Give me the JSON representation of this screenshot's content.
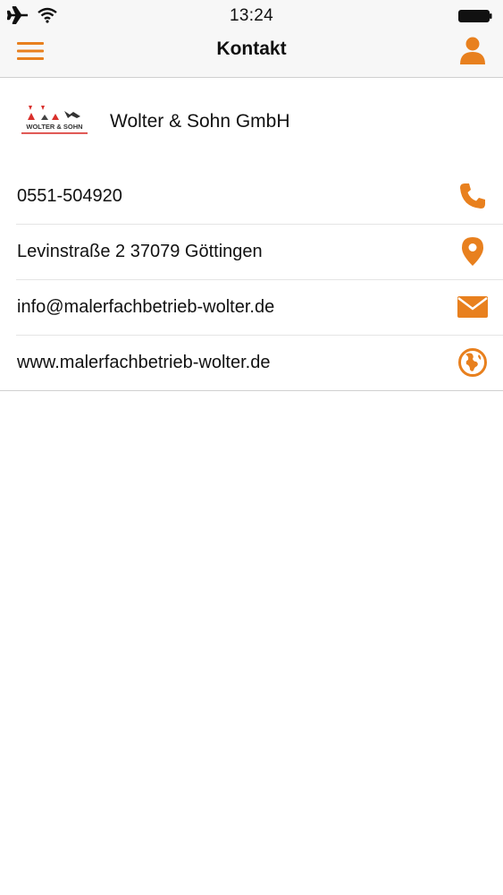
{
  "status_bar": {
    "time": "13:24"
  },
  "nav": {
    "title": "Kontakt"
  },
  "company": {
    "name": "Wolter & Sohn GmbH",
    "logo_text": "WOLTER & SOHN"
  },
  "contacts": [
    {
      "label": "0551-504920",
      "icon": "phone-icon"
    },
    {
      "label": "Levinstraße 2 37079 Göttingen",
      "icon": "location-pin-icon"
    },
    {
      "label": "info@malerfachbetrieb-wolter.de",
      "icon": "mail-icon"
    },
    {
      "label": "www.malerfachbetrieb-wolter.de",
      "icon": "globe-icon"
    }
  ],
  "colors": {
    "accent": "#e8801e",
    "header_bg": "#f7f7f7",
    "text": "#111111"
  }
}
